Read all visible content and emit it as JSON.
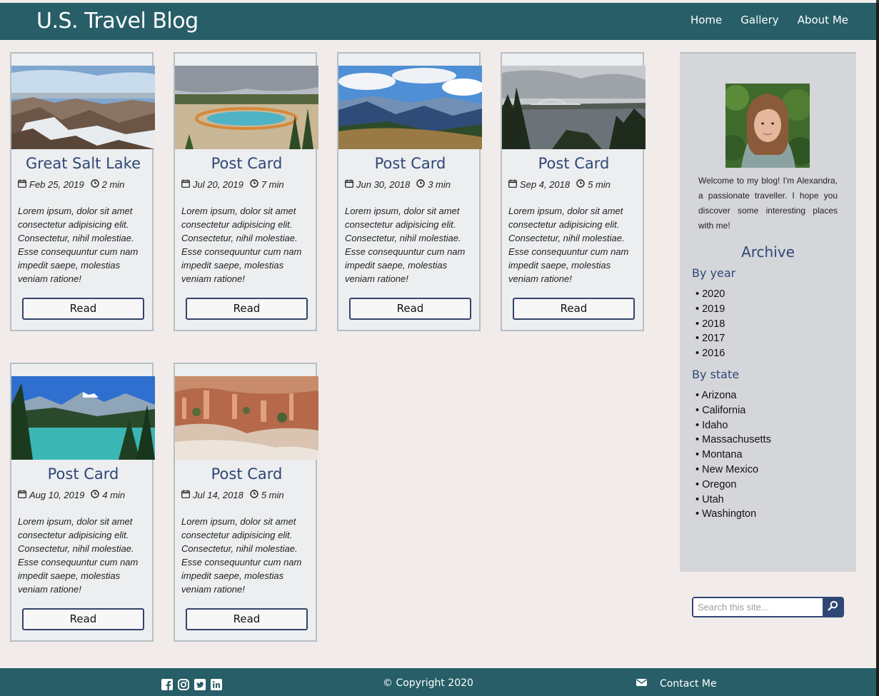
{
  "header": {
    "site_title": "U.S. Travel Blog",
    "nav": [
      "Home",
      "Gallery",
      "About Me"
    ]
  },
  "cards": [
    {
      "title": "Great Salt Lake",
      "date": "Feb 25, 2019",
      "read_time": "2 min",
      "excerpt": "Lorem ipsum, dolor sit amet consectetur adipisicing elit. Consectetur, nihil molestiae. Esse consequuntur cum nam impedit saepe, molestias veniam ratione!",
      "button": "Read",
      "image": "snowy-rocks-lake"
    },
    {
      "title": "Post Card",
      "date": "Jul 20, 2019",
      "read_time": "7 min",
      "excerpt": "Lorem ipsum, dolor sit amet consectetur adipisicing elit. Consectetur, nihil molestiae. Esse consequuntur cum nam impedit saepe, molestias veniam ratione!",
      "button": "Read",
      "image": "hot-spring"
    },
    {
      "title": "Post Card",
      "date": "Jun 30, 2018",
      "read_time": "3 min",
      "excerpt": "Lorem ipsum, dolor sit amet consectetur adipisicing elit. Consectetur, nihil molestiae. Esse consequuntur cum nam impedit saepe, molestias veniam ratione!",
      "button": "Read",
      "image": "mountain-ridge"
    },
    {
      "title": "Post Card",
      "date": "Sep 4, 2018",
      "read_time": "5 min",
      "excerpt": "Lorem ipsum, dolor sit amet consectetur adipisicing elit. Consectetur, nihil molestiae. Esse consequuntur cum nam impedit saepe, molestias veniam ratione!",
      "button": "Read",
      "image": "bay-bridge"
    },
    {
      "title": "Post Card",
      "date": "Aug 10, 2019",
      "read_time": "4 min",
      "excerpt": "Lorem ipsum, dolor sit amet consectetur adipisicing elit. Consectetur, nihil molestiae. Esse consequuntur cum nam impedit saepe, molestias veniam ratione!",
      "button": "Read",
      "image": "turquoise-lake"
    },
    {
      "title": "Post Card",
      "date": "Jul 14, 2018",
      "read_time": "5 min",
      "excerpt": "Lorem ipsum, dolor sit amet consectetur adipisicing elit. Consectetur, nihil molestiae. Esse consequuntur cum nam impedit saepe, molestias veniam ratione!",
      "button": "Read",
      "image": "canyon-hoodoos"
    }
  ],
  "sidebar": {
    "bio": "Welcome to my blog! I'm Alexandra, a passionate traveller. I hope you discover some interesting places with me!",
    "archive_title": "Archive",
    "by_year_title": "By year",
    "years": [
      "2020",
      "2019",
      "2018",
      "2017",
      "2016"
    ],
    "by_state_title": "By state",
    "states": [
      "Arizona",
      "California",
      "Idaho",
      "Massachusetts",
      "Montana",
      "New Mexico",
      "Oregon",
      "Utah",
      "Washington"
    ]
  },
  "search": {
    "placeholder": "Search this site..."
  },
  "footer": {
    "social_icons": [
      "facebook-icon",
      "instagram-icon",
      "twitter-icon",
      "linkedin-icon"
    ],
    "copyright": "© Copyright 2020",
    "contact": "Contact Me"
  },
  "colors": {
    "header_bg": "#275e67",
    "page_bg": "#f1ecea",
    "card_bg": "#eceef0",
    "accent": "#2f4776",
    "sidebar_bg": "#d5d6da"
  }
}
